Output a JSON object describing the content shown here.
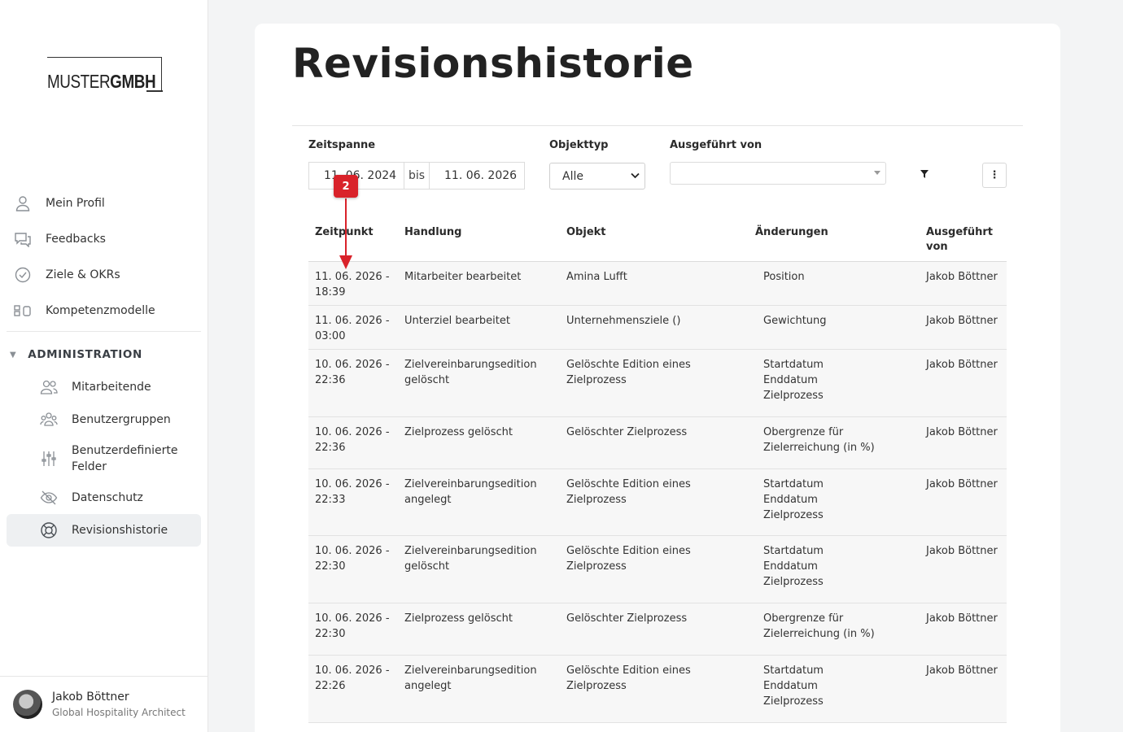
{
  "logo": {
    "part1": "MUSTER",
    "part2": "GMBH"
  },
  "nav": {
    "items": [
      {
        "label": "Mein Profil",
        "icon": "user-icon"
      },
      {
        "label": "Feedbacks",
        "icon": "chat-bubbles-icon"
      },
      {
        "label": "Ziele & OKRs",
        "icon": "check-circle-icon"
      },
      {
        "label": "Kompetenzmodelle",
        "icon": "blocks-icon"
      }
    ],
    "section_label": "ADMINISTRATION",
    "sub_items": [
      {
        "label": "Mitarbeitende",
        "icon": "people-icon"
      },
      {
        "label": "Benutzergruppen",
        "icon": "group-icon"
      },
      {
        "label": "Benutzerdefinierte Felder",
        "icon": "sliders-icon"
      },
      {
        "label": "Datenschutz",
        "icon": "eye-off-icon"
      },
      {
        "label": "Revisionshistorie",
        "icon": "lifebuoy-icon"
      }
    ]
  },
  "user": {
    "name": "Jakob Böttner",
    "role": "Global Hospitality Architect"
  },
  "page": {
    "title": "Revisionshistorie"
  },
  "filters": {
    "timespan_label": "Zeitspanne",
    "date_from": "11. 06. 2024",
    "bis": "bis",
    "date_to": "11. 06. 2026",
    "objecttype_label": "Objekttyp",
    "objecttype_value": "Alle",
    "executed_by_label": "Ausgeführt von",
    "executed_by_value": ""
  },
  "table": {
    "headers": [
      "Zeitpunkt",
      "Handlung",
      "Objekt",
      "Änderungen",
      "Ausgeführt von"
    ],
    "rows": [
      {
        "time": "11. 06. 2026 - 18:39",
        "action": "Mitarbeiter bearbeitet",
        "object": "Amina Lufft",
        "changes": "Position",
        "by": "Jakob Böttner"
      },
      {
        "time": "11. 06. 2026 - 03:00",
        "action": "Unterziel bearbeitet",
        "object": "Unternehmensziele ()",
        "changes": "Gewichtung",
        "by": "Jakob Böttner"
      },
      {
        "time": "10. 06. 2026 - 22:36",
        "action": "Zielvereinbarungsedition gelöscht",
        "object": "Gelöschte Edition eines Zielprozess",
        "changes": "Startdatum\nEnddatum\nZielprozess",
        "by": "Jakob Böttner"
      },
      {
        "time": "10. 06. 2026 - 22:36",
        "action": "Zielprozess gelöscht",
        "object": "Gelöschter Zielprozess",
        "changes": "Obergrenze für Zielerreichung (in %)",
        "by": "Jakob Böttner"
      },
      {
        "time": "10. 06. 2026 - 22:33",
        "action": "Zielvereinbarungsedition angelegt",
        "object": "Gelöschte Edition eines Zielprozess",
        "changes": "Startdatum\nEnddatum\nZielprozess",
        "by": "Jakob Böttner"
      },
      {
        "time": "10. 06. 2026 - 22:30",
        "action": "Zielvereinbarungsedition gelöscht",
        "object": "Gelöschte Edition eines Zielprozess",
        "changes": "Startdatum\nEnddatum\nZielprozess",
        "by": "Jakob Böttner"
      },
      {
        "time": "10. 06. 2026 - 22:30",
        "action": "Zielprozess gelöscht",
        "object": "Gelöschter Zielprozess",
        "changes": "Obergrenze für Zielerreichung (in %)",
        "by": "Jakob Böttner"
      },
      {
        "time": "10. 06. 2026 - 22:26",
        "action": "Zielvereinbarungsedition angelegt",
        "object": "Gelöschte Edition eines Zielprozess",
        "changes": "Startdatum\nEnddatum\nZielprozess",
        "by": "Jakob Böttner"
      }
    ]
  },
  "annotation": {
    "badge": "2",
    "color": "#d9222a"
  }
}
